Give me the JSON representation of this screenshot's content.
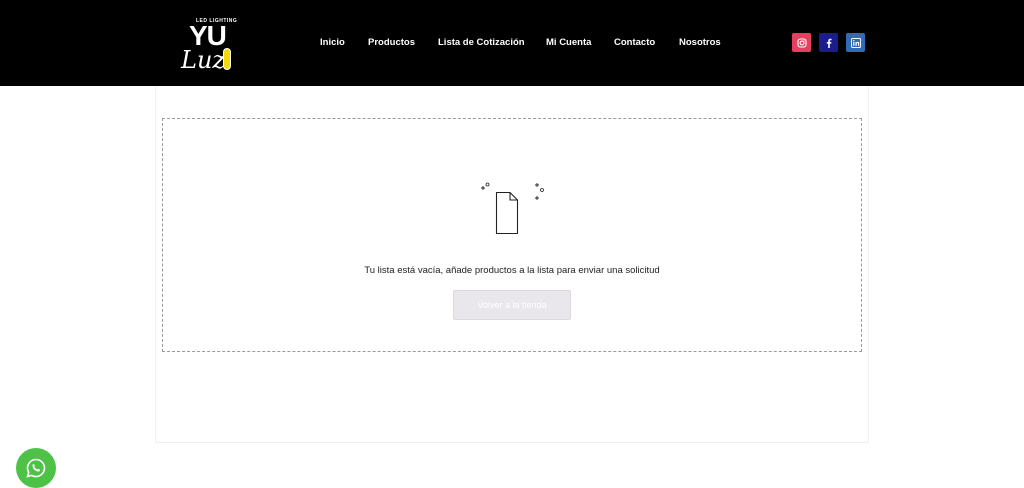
{
  "brand": {
    "logo_top": "LED LIGHTING",
    "logo_main": "YU",
    "logo_sub": "Luz"
  },
  "nav": {
    "items": [
      {
        "label": "Inicio"
      },
      {
        "label": "Productos"
      },
      {
        "label": "Lista de Cotización"
      },
      {
        "label": "Mi Cuenta"
      },
      {
        "label": "Contacto"
      },
      {
        "label": "Nosotros"
      }
    ]
  },
  "social": [
    {
      "name": "instagram",
      "icon": "instagram-icon",
      "color": "#e4405f"
    },
    {
      "name": "facebook",
      "icon": "facebook-icon",
      "color": "#1c1c8c"
    },
    {
      "name": "linkedin",
      "icon": "linkedin-icon",
      "color": "#2f6cb5"
    }
  ],
  "main": {
    "empty_message": "Tu lista está vacía, añade productos a la lista para enviar una solicitud",
    "back_button_label": "Volver a la tienda"
  },
  "whatsapp": {
    "icon": "whatsapp-icon",
    "color": "#4dc247"
  }
}
